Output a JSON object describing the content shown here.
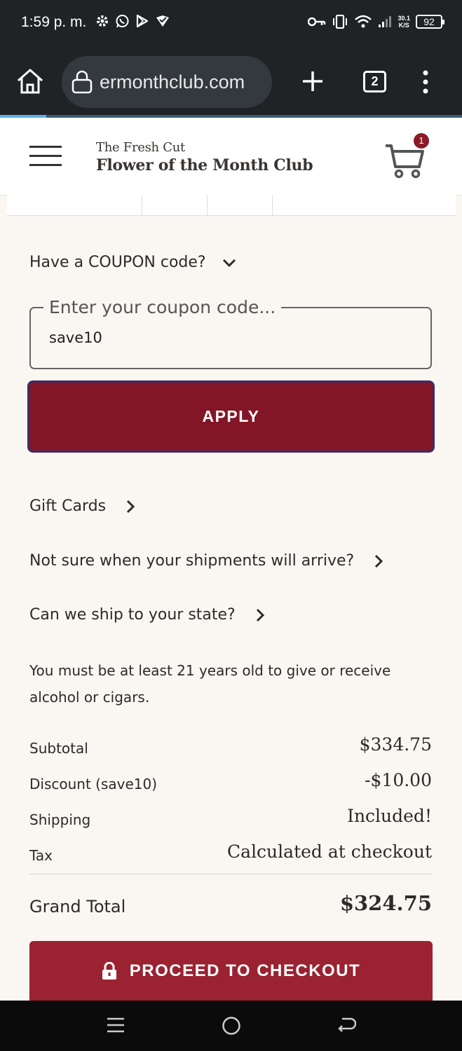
{
  "status_bar": {
    "time": "1:59 p. m.",
    "net_speed_value": "30.1",
    "net_speed_unit": "K/S",
    "battery": "92"
  },
  "browser": {
    "url": "ermonthclub.com",
    "tab_count": "2"
  },
  "header": {
    "logo_line1": "The Fresh Cut",
    "logo_line2": "Flower of the Month Club",
    "cart_count": "1"
  },
  "coupon": {
    "toggle_label": "Have a COUPON code?",
    "field_label": "Enter your coupon code...",
    "value": "save10",
    "apply_label": "APPLY"
  },
  "links": {
    "gift_cards": "Gift Cards",
    "shipments": "Not sure when your shipments will arrive?",
    "ship_state": "Can we ship to your state?"
  },
  "notice": "You must be at least 21 years old to give or receive alcohol or cigars.",
  "totals": [
    {
      "label": "Subtotal",
      "amount": "$334.75"
    },
    {
      "label": "Discount (save10)",
      "amount": "-$10.00"
    },
    {
      "label": "Shipping",
      "amount": "Included!"
    },
    {
      "label": "Tax",
      "amount": "Calculated at checkout"
    }
  ],
  "grand_total": {
    "label": "Grand Total",
    "amount": "$324.75"
  },
  "checkout_label": "PROCEED TO CHECKOUT",
  "colors": {
    "apply_bg": "#831626",
    "checkout_bg": "#9b2230",
    "page_bg": "#faf6f2",
    "browser_bg": "#1f2326"
  }
}
